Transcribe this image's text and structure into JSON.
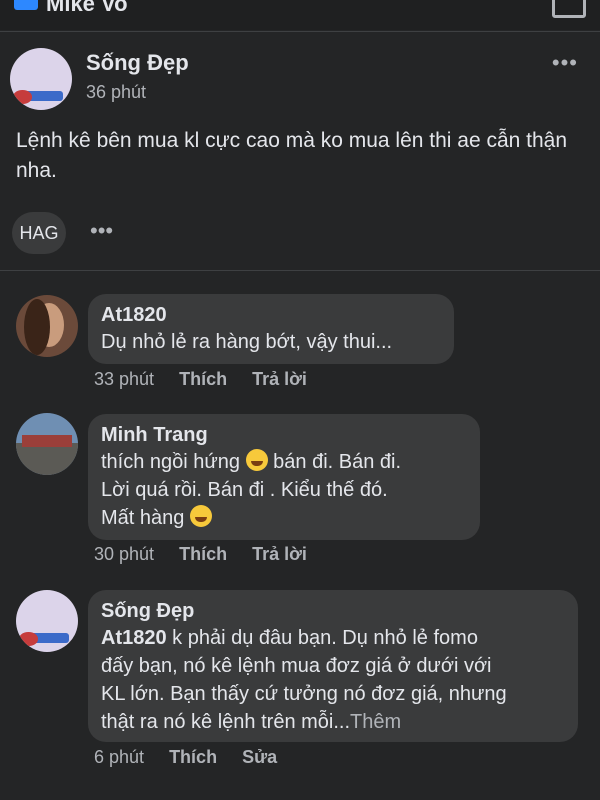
{
  "topbar": {
    "name": "Mike Vo"
  },
  "post": {
    "author": "Sống Đẹp",
    "time": "36 phút",
    "text": "Lệnh kê bên mua kl cực cao mà ko mua lên thi ae cẫn thận nha.",
    "tag": "HAG"
  },
  "comments": [
    {
      "name": "At1820",
      "lines": [
        "Dụ nhỏ lẻ ra hàng bớt, vậy thui..."
      ],
      "time": "33 phút",
      "like": "Thích",
      "reply": "Trả lời"
    },
    {
      "name": "Minh Trang",
      "line1_a": "thích ngồi hứng",
      "line1_b": "bán đi. Bán đi.",
      "line2": "Lời quá rồi. Bán đi . Kiểu thế đó.",
      "line3": "Mất hàng",
      "time": "30 phút",
      "like": "Thích",
      "reply": "Trả lời"
    },
    {
      "name": "Sống Đẹp",
      "mention": "At1820",
      "line1": "k phải dụ đâu bạn. Dụ nhỏ lẻ fomo",
      "line2": "đấy bạn, nó kê lệnh mua đơz giá ở dưới với",
      "line3": "KL lớn. Bạn thấy cứ tưởng nó đơz giá, nhưng",
      "line4": "thật ra nó kê lệnh trên mỗi...",
      "see_more": "Thêm",
      "time": "6 phút",
      "like": "Thích",
      "edit": "Sửa"
    }
  ],
  "icons": {
    "more": "more-horizontal-icon",
    "emoji1": "laughing-tears-emoji-icon",
    "emoji2": "grinning-squint-emoji-icon"
  }
}
